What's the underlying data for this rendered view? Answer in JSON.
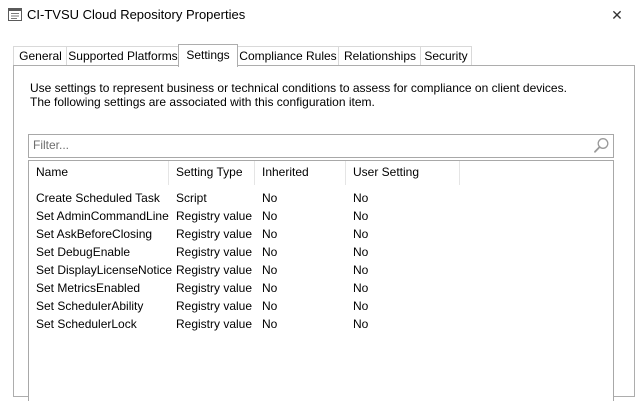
{
  "window": {
    "title": "CI-TVSU Cloud Repository Properties",
    "close_glyph": "✕",
    "icon": "properties-window-icon"
  },
  "tabs": [
    {
      "label": "General",
      "active": false
    },
    {
      "label": "Supported Platforms",
      "active": false
    },
    {
      "label": "Settings",
      "active": true
    },
    {
      "label": "Compliance Rules",
      "active": false
    },
    {
      "label": "Relationships",
      "active": false
    },
    {
      "label": "Security",
      "active": false
    }
  ],
  "settings_page": {
    "description": "Use settings to represent business or technical conditions to assess for compliance on client devices. The following settings are associated with this configuration item.",
    "filter": {
      "placeholder": "Filter...",
      "value": "",
      "icon": "search-icon"
    },
    "columns": [
      "Name",
      "Setting Type",
      "Inherited",
      "User Setting"
    ],
    "rows": [
      {
        "name": "Create Scheduled Task",
        "setting_type": "Script",
        "inherited": "No",
        "user_setting": "No"
      },
      {
        "name": "Set AdminCommandLine",
        "setting_type": "Registry value",
        "inherited": "No",
        "user_setting": "No"
      },
      {
        "name": "Set AskBeforeClosing",
        "setting_type": "Registry value",
        "inherited": "No",
        "user_setting": "No"
      },
      {
        "name": "Set DebugEnable",
        "setting_type": "Registry value",
        "inherited": "No",
        "user_setting": "No"
      },
      {
        "name": "Set DisplayLicenseNotice",
        "setting_type": "Registry value",
        "inherited": "No",
        "user_setting": "No"
      },
      {
        "name": "Set MetricsEnabled",
        "setting_type": "Registry value",
        "inherited": "No",
        "user_setting": "No"
      },
      {
        "name": "Set SchedulerAbility",
        "setting_type": "Registry value",
        "inherited": "No",
        "user_setting": "No"
      },
      {
        "name": "Set SchedulerLock",
        "setting_type": "Registry value",
        "inherited": "No",
        "user_setting": "No"
      }
    ]
  },
  "colors": {
    "window_bg": "#ffffff",
    "border": "#adadad",
    "placeholder_text": "#6d6d6d"
  }
}
